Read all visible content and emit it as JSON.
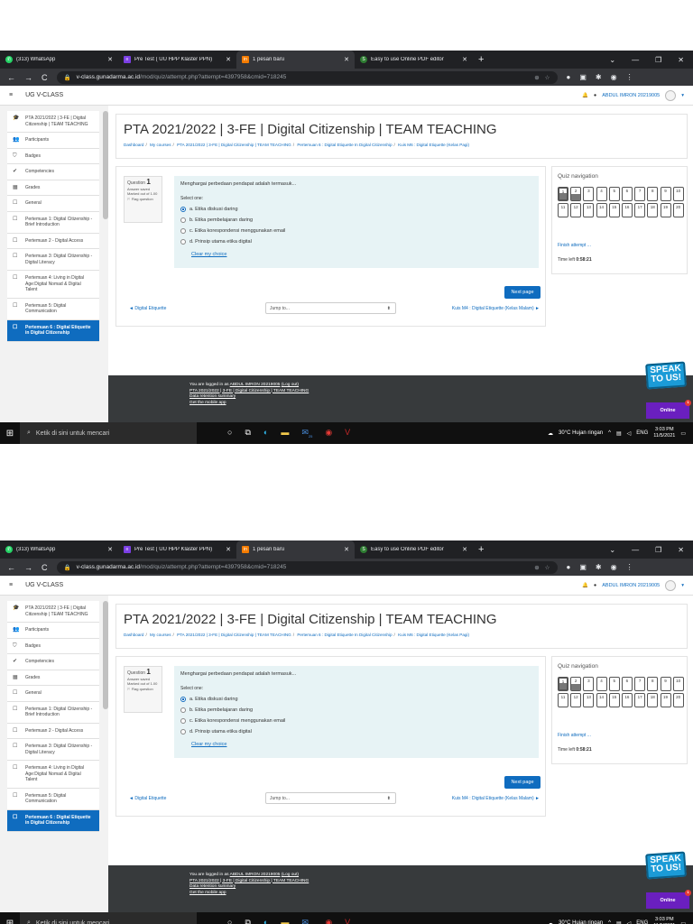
{
  "tabs": [
    {
      "label": "(313) WhatsApp",
      "favicon_color": "#25d366"
    },
    {
      "label": "Pre Test ( UU HPP Klaster PPN)",
      "favicon_color": "#7b3fe4"
    },
    {
      "label": "1 pesan baru",
      "favicon_color": "#f57c00"
    },
    {
      "label": "Easy to use Online PDF editor",
      "favicon_color": "#2e7d32"
    }
  ],
  "url": {
    "host": "v-class.gunadarma.ac.id",
    "path": "/mod/quiz/attempt.php?attempt=4397958&cmid=718245"
  },
  "topnav": {
    "site_name": "UG V-CLASS",
    "user": "ABDUL IMRON 20219005"
  },
  "drawer": {
    "items": [
      {
        "label": "PTA 2021/2022 | 3-FE | Digital Citizenship | TEAM TEACHING",
        "icon": "graduation-cap-icon"
      },
      {
        "label": "Participants",
        "icon": "users-icon"
      },
      {
        "label": "Badges",
        "icon": "badge-icon"
      },
      {
        "label": "Competencies",
        "icon": "check-icon"
      },
      {
        "label": "Grades",
        "icon": "table-icon"
      },
      {
        "label": "General",
        "icon": "folder-icon"
      },
      {
        "label": "Pertemuan 1: Digital Citizenship - Brief Introduction",
        "icon": "folder-icon"
      },
      {
        "label": "Pertemuan 2 - Digital Access",
        "icon": "folder-icon"
      },
      {
        "label": "Pertemuan 3: Digital Citizenship - Digital Literacy",
        "icon": "folder-icon"
      },
      {
        "label": "Pertemuan 4: Living in Digital Age:Digital Nomad & Digital Talent",
        "icon": "folder-icon"
      },
      {
        "label": "Pertemuan 5: Digital Communication",
        "icon": "folder-icon"
      },
      {
        "label": "Pertemuan 6 : Digital Etiquette in Digital Citizenship",
        "icon": "folder-icon"
      }
    ]
  },
  "page": {
    "title": "PTA 2021/2022 | 3-FE | Digital Citizenship | TEAM TEACHING",
    "breadcrumb": [
      "Dashboard",
      "My courses",
      "PTA 2021/2022 | 3-FE | Digital Citizenship | TEAM TEACHING",
      "Pertemuan 6 : Digital Etiquette In Digital Citizenship",
      "Kuis M6 : Digital Etiquette (Kelas Pagi)"
    ]
  },
  "question": {
    "label": "Question",
    "number": "1",
    "status": "Answer saved",
    "marks": "Marked out of 1.00",
    "flag": "Flag question",
    "text": "Menghargai perbedaan pendapat adalah termasuk...",
    "select_label": "Select one:",
    "options": [
      {
        "label": "a. Etika diskusi daring",
        "selected": true
      },
      {
        "label": "b. Etika pembelajaran daring",
        "selected": false
      },
      {
        "label": "c. Etika korespondensi menggunakan email",
        "selected": false
      },
      {
        "label": "d. Prinsip utama etika digital",
        "selected": false
      }
    ],
    "clear": "Clear my choice",
    "next": "Next page",
    "prev_activity": "◄ Digital Etiquette",
    "jump": "Jump to...",
    "next_activity": "Kuis M4 : Digital Etiquette (Kelas Malam) ►"
  },
  "quiz_nav": {
    "title": "Quiz navigation",
    "finish": "Finish attempt ...",
    "time_label": "Time left",
    "time_value": "0:58:21",
    "slots": [
      "1",
      "2",
      "3",
      "4",
      "5",
      "6",
      "7",
      "8",
      "9",
      "10",
      "11",
      "12",
      "13",
      "14",
      "15",
      "16",
      "17",
      "18",
      "19",
      "20"
    ]
  },
  "footer": {
    "logged_in_prefix": "You are logged in as",
    "user": "ABDUL IMRON 20219005",
    "logout": "(Log out)",
    "course": "PTA 2021/2022 | 3-FE | Digital Citizenship | TEAM TEACHING",
    "retention": "Data retention summary",
    "mobile": "Get the mobile app",
    "speak": "SPEAK TO US!",
    "online": "Online",
    "online_count": "1"
  },
  "taskbar": {
    "search": "Ketik di sini untuk mencari",
    "weather": "30°C  Hujan ringan",
    "lang": "ENG",
    "time": "3:03 PM",
    "date": "11/5/2021",
    "badge": "25"
  }
}
